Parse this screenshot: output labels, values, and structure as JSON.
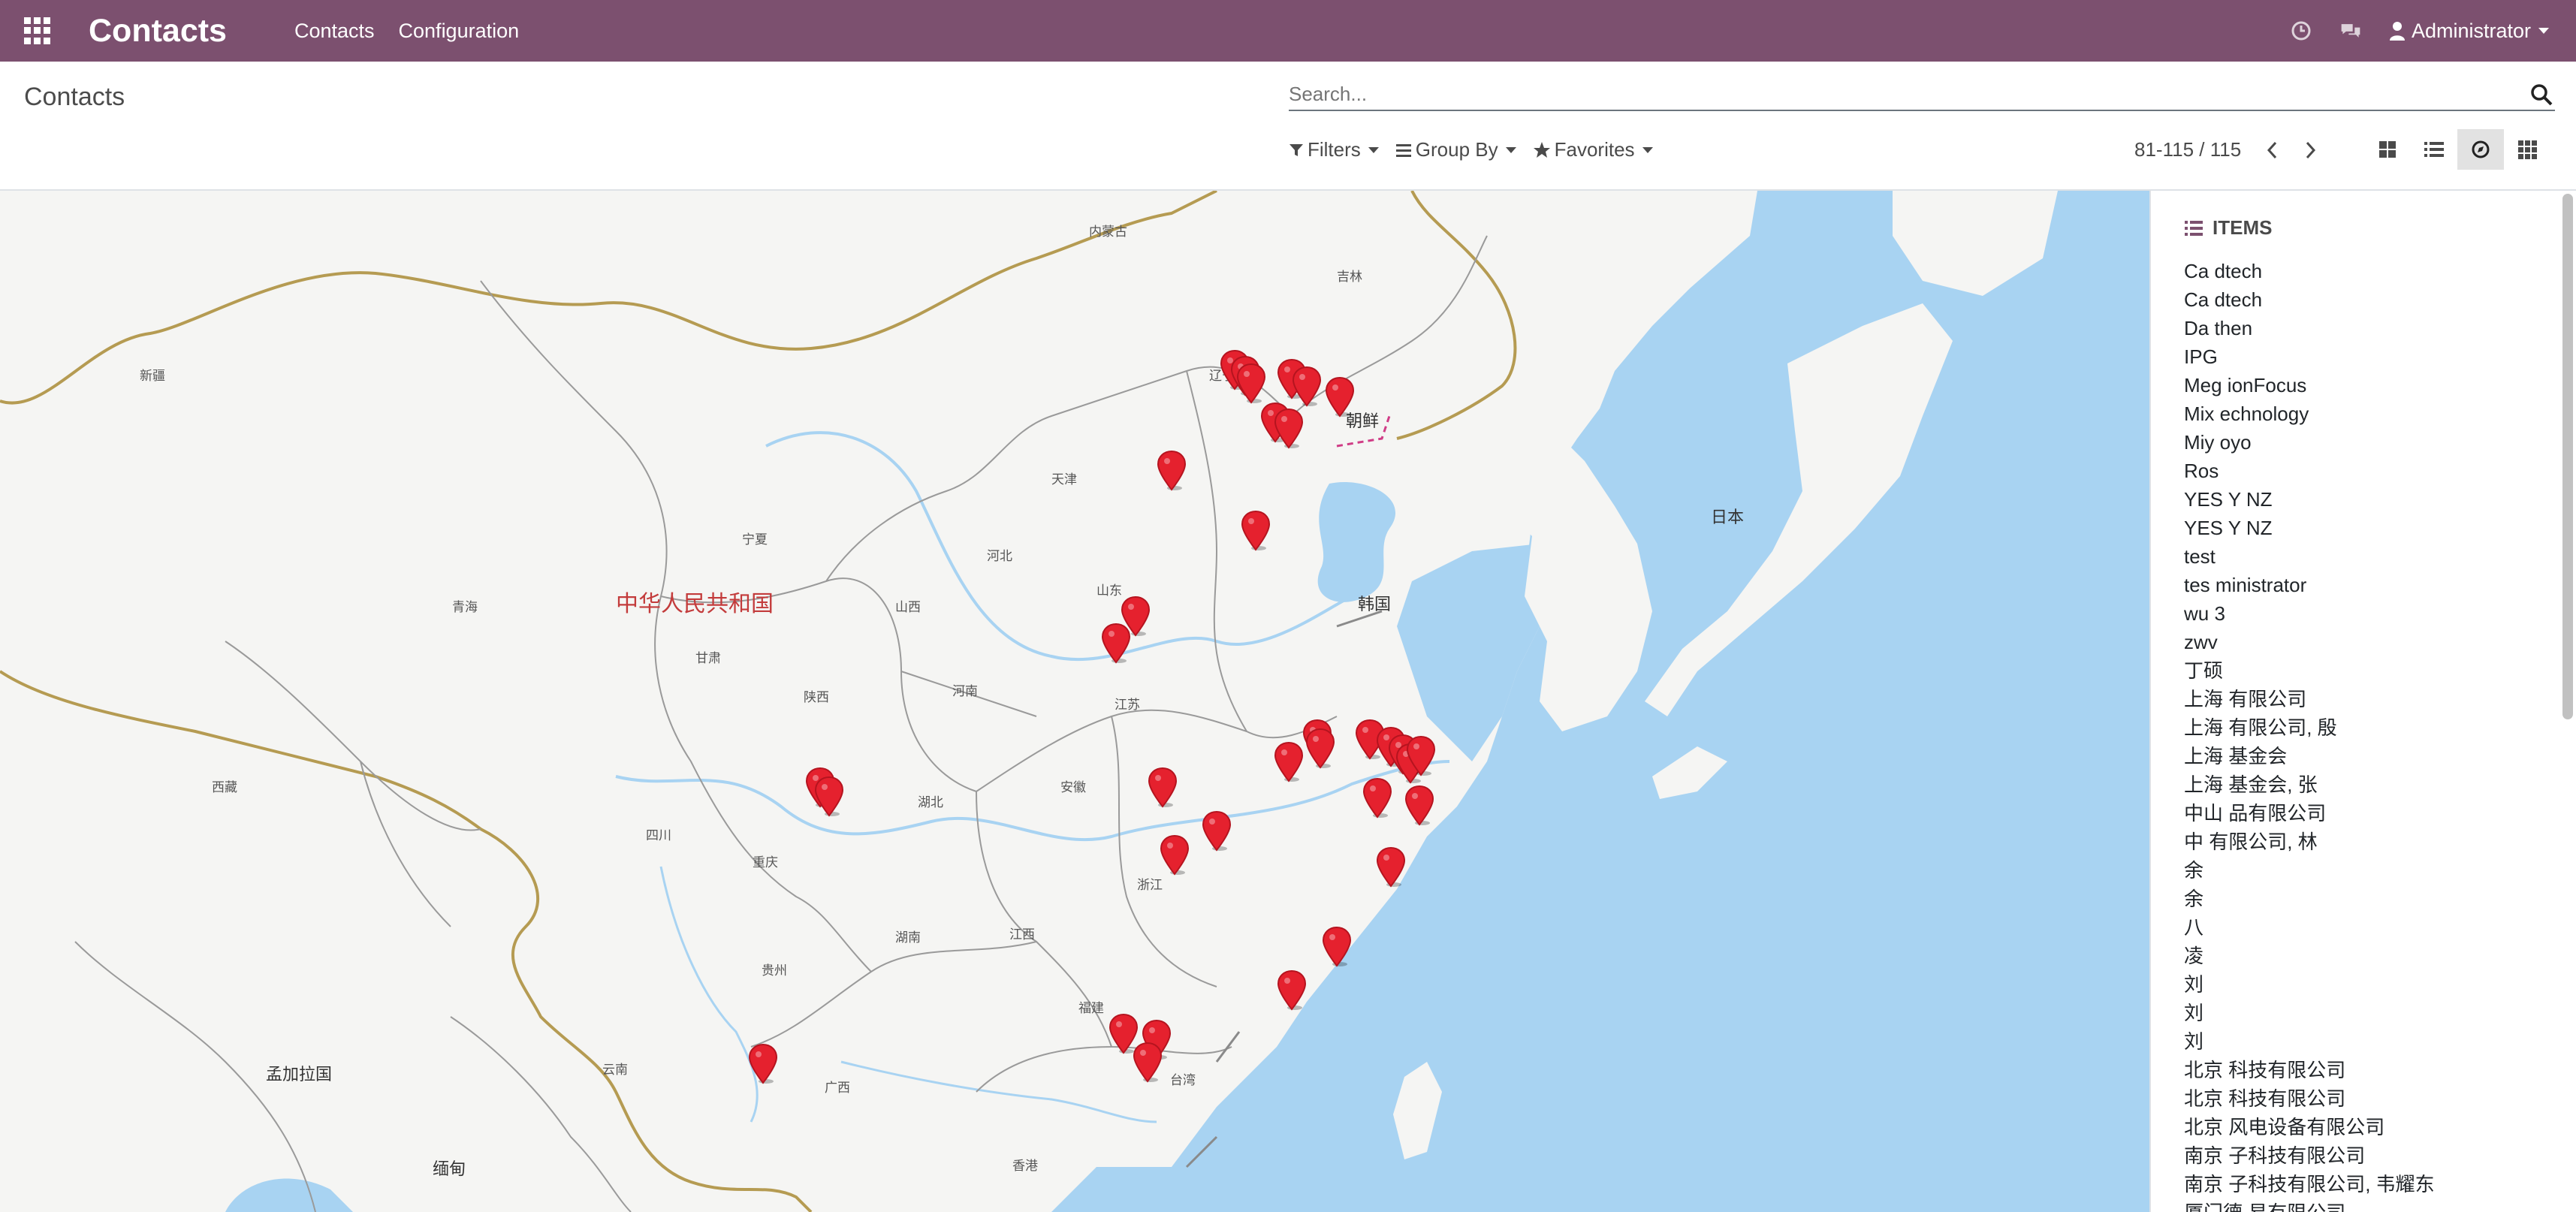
{
  "navbar": {
    "brand": "Contacts",
    "menu": [
      "Contacts",
      "Configuration"
    ],
    "user": "Administrator",
    "bg_color": "#7c506f"
  },
  "control_panel": {
    "breadcrumb": "Contacts",
    "search_placeholder": "Search...",
    "filters_label": "Filters",
    "groupby_label": "Group By",
    "favorites_label": "Favorites",
    "pager": "81-115 / 115",
    "views": [
      "kanban-icon",
      "list-icon",
      "map-icon",
      "grid-icon"
    ],
    "active_view": "map-icon"
  },
  "map": {
    "country_label": "中华人民共和国",
    "labels": {
      "neimenggu": "内蒙古",
      "jilin": "吉林",
      "xinjiang": "新疆",
      "liaoning": "辽宁",
      "chaoxian": "朝鲜",
      "ningxia": "宁夏",
      "tianjin": "天津",
      "riben": "日本",
      "hebei": "河北",
      "qinghai": "青海",
      "shanxi": "山西",
      "shandong": "山东",
      "hanguo": "韩国",
      "gansu": "甘肃",
      "xizang": "西藏",
      "shaanxi": "陕西",
      "henan": "河南",
      "jiangsu": "江苏",
      "hubei": "湖北",
      "anhui": "安徽",
      "sichuan": "四川",
      "chongqing": "重庆",
      "zhejiang": "浙江",
      "hunan": "湖南",
      "jiangxi": "江西",
      "guizhou": "贵州",
      "fujian": "福建",
      "mengjiala": "孟加拉国",
      "yunnan": "云南",
      "guangxi": "广西",
      "taiwan": "台湾",
      "miandian": "缅甸",
      "xianggang": "香港"
    },
    "marker_color": "#e5212e",
    "marker_count": 34
  },
  "items_panel": {
    "heading": "ITEMS",
    "items": [
      "Ca     dtech",
      "Ca     dtech",
      "Da     then",
      "IPG",
      "Meg     ionFocus",
      "Mix     echnology",
      "Miy     oyo",
      "Ros",
      "YES     Y NZ",
      "YES     Y NZ",
      "test",
      "tes     ministrator",
      "wu     3",
      "zwv",
      "丁硕",
      "上海     有限公司",
      "上海     有限公司, 殷",
      "上海     基金会",
      "上海     基金会, 张",
      "中山     品有限公司",
      "中     有限公司,     林",
      "余",
      "余",
      "八",
      "凌",
      "刘",
      "刘",
      "刘",
      "北京     科技有限公司",
      "北京     科技有限公司",
      "北京     风电设备有限公司",
      "南京     子科技有限公司",
      "南京     子科技有限公司, 韦耀东",
      "厦门德     易有限公司"
    ]
  }
}
